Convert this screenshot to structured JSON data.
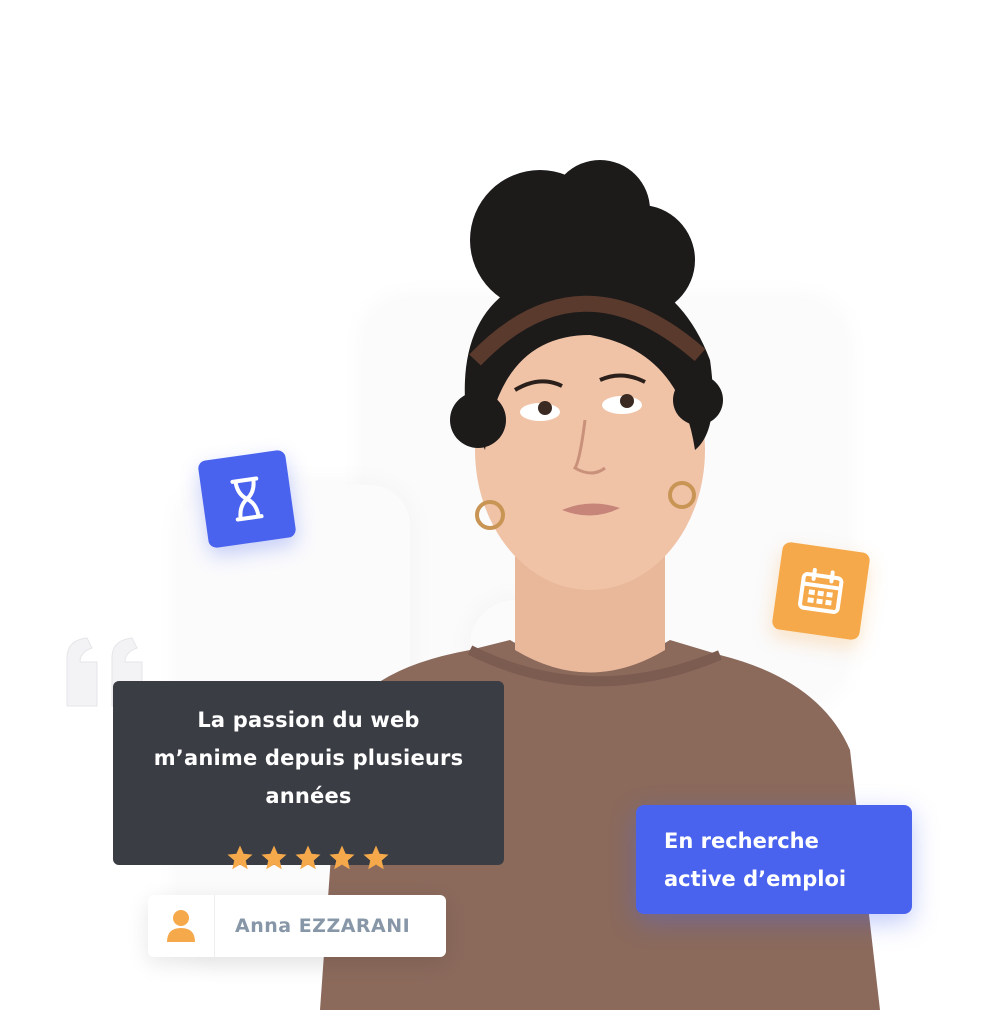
{
  "quote": {
    "lines": [
      "La passion du web",
      "m’anime depuis plusieurs",
      "années"
    ]
  },
  "rating": {
    "stars": 5,
    "max": 5
  },
  "person": {
    "name": "Anna EZZARANI"
  },
  "status": {
    "lines": [
      "En recherche",
      "active d’emploi"
    ]
  },
  "icons": {
    "hourglass": "hourglass-icon",
    "calendar": "calendar-icon",
    "user": "user-icon",
    "quote": "quote-mark-icon",
    "star": "star-icon"
  },
  "colors": {
    "blue": "#4a63ef",
    "orange": "#f6a94a",
    "dark": "#3a3d44",
    "name_gray": "#8797a8",
    "sweater": "#8b6a5c"
  }
}
